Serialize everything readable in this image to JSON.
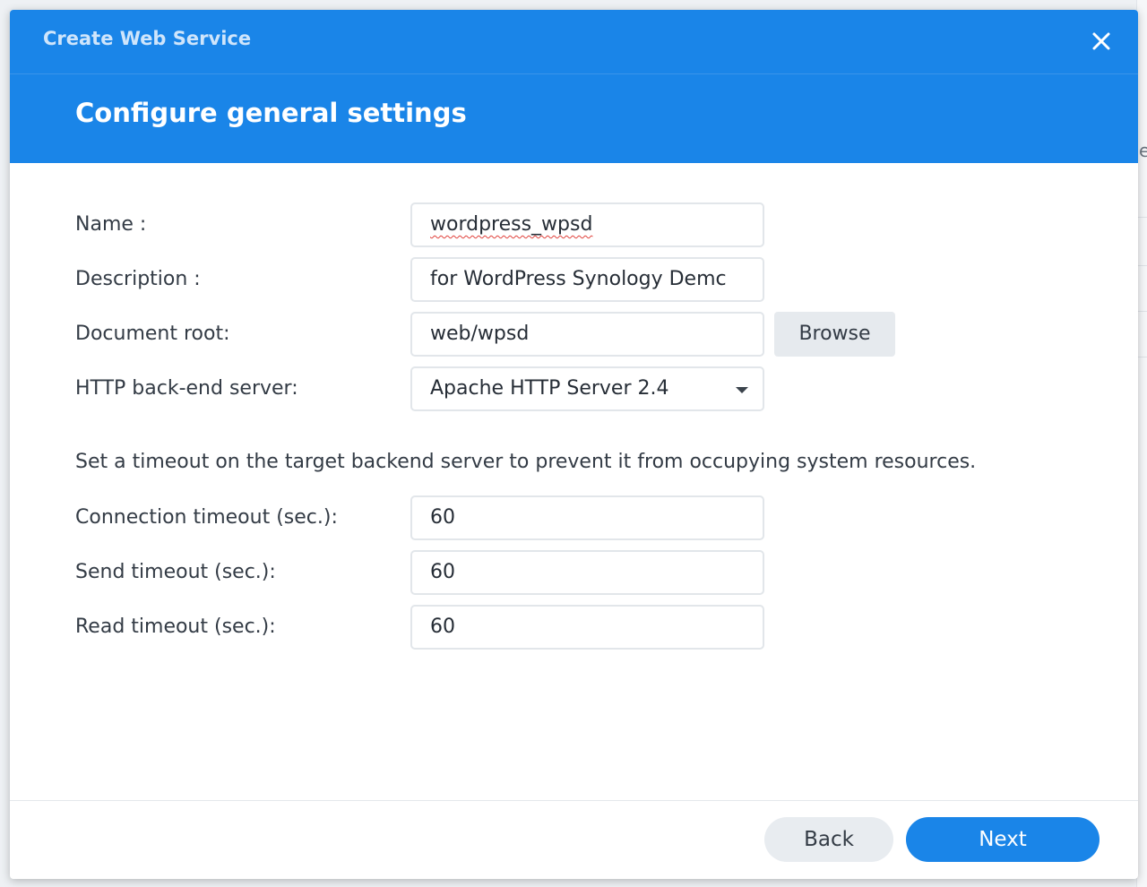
{
  "window": {
    "title": "Create Web Service",
    "close_icon": "close-icon"
  },
  "header": {
    "title": "Configure general settings"
  },
  "form": {
    "name": {
      "label": "Name :",
      "value": "wordpress_wpsd"
    },
    "description": {
      "label": "Description :",
      "value": "for WordPress Synology Demc"
    },
    "document_root": {
      "label": "Document root:",
      "value": "web/wpsd",
      "browse_label": "Browse"
    },
    "backend_server": {
      "label": "HTTP back-end server:",
      "selected": "Apache HTTP Server 2.4"
    }
  },
  "timeouts": {
    "info": "Set a timeout on the target backend server to prevent it from occupying system resources.",
    "connection": {
      "label": "Connection timeout (sec.):",
      "value": "60"
    },
    "send": {
      "label": "Send timeout (sec.):",
      "value": "60"
    },
    "read": {
      "label": "Read timeout (sec.):",
      "value": "60"
    }
  },
  "footer": {
    "back_label": "Back",
    "next_label": "Next"
  },
  "colors": {
    "header_blue": "#1a85e8",
    "primary_button": "#1a85e8",
    "secondary_button": "#e8ecf0"
  }
}
